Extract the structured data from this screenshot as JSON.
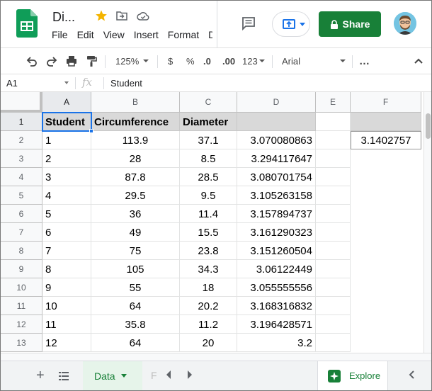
{
  "app": {
    "title": "Di...",
    "menu": [
      "File",
      "Edit",
      "View",
      "Insert",
      "Format",
      "D"
    ],
    "share_label": "Share",
    "colors": {
      "brand_green": "#188038",
      "accent_blue": "#1a73e8",
      "header_gray": "#d9d9d9"
    }
  },
  "toolbar": {
    "zoom": "125%",
    "currency": "$",
    "percent": "%",
    "dec_decrease": ".0",
    "dec_increase": ".00",
    "format_more": "123",
    "font": "Arial",
    "more": "…"
  },
  "formula_bar": {
    "cell_ref": "A1",
    "fx": "fx",
    "value": "Student"
  },
  "grid": {
    "columns": [
      "A",
      "B",
      "C",
      "D",
      "E",
      "F"
    ],
    "rows": [
      "1",
      "2",
      "3",
      "4",
      "5",
      "6",
      "7",
      "8",
      "9",
      "10",
      "11",
      "12",
      "13"
    ],
    "headers": [
      "Student",
      "Circumference",
      "Diameter",
      ""
    ],
    "data": [
      [
        "1",
        "113.9",
        "37.1",
        "3.070080863"
      ],
      [
        "2",
        "28",
        "8.5",
        "3.294117647"
      ],
      [
        "3",
        "87.8",
        "28.5",
        "3.080701754"
      ],
      [
        "4",
        "29.5",
        "9.5",
        "3.105263158"
      ],
      [
        "5",
        "36",
        "11.4",
        "3.157894737"
      ],
      [
        "6",
        "49",
        "15.5",
        "3.161290323"
      ],
      [
        "7",
        "75",
        "23.8",
        "3.151260504"
      ],
      [
        "8",
        "105",
        "34.3",
        "3.06122449"
      ],
      [
        "9",
        "55",
        "18",
        "3.055555556"
      ],
      [
        "10",
        "64",
        "20.2",
        "3.168316832"
      ],
      [
        "11",
        "35.8",
        "11.2",
        "3.196428571"
      ],
      [
        "12",
        "64",
        "20",
        "3.2"
      ]
    ],
    "f2_value": "3.1402757"
  },
  "sheets": {
    "active": "Data",
    "next_tab_cut": "F",
    "explore_label": "Explore"
  }
}
